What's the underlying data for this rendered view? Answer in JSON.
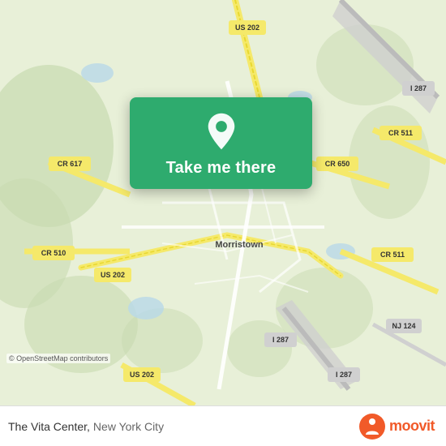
{
  "map": {
    "attribution": "© OpenStreetMap contributors"
  },
  "card": {
    "button_label": "Take me there",
    "pin_icon": "location-pin"
  },
  "bottom_bar": {
    "location_name": "The Vita Center,",
    "location_city": "New York City",
    "logo_text": "moovit"
  },
  "roads": {
    "cr617": "CR 617",
    "cr650": "CR 650",
    "cr511_top": "CR 511",
    "cr511_mid": "CR 511",
    "cr510": "CR 510",
    "us202_top": "US 202",
    "us202_mid": "US 202",
    "us202_bot": "US 202",
    "i287_top": "I 287",
    "i287_bot": "I 287",
    "nj124": "NJ 124",
    "morristown": "Morristown"
  },
  "colors": {
    "card_green": "#2eab6e",
    "map_bg": "#e8f0d8",
    "road_yellow": "#f5e96a",
    "road_white": "#ffffff",
    "road_gray": "#cccccc",
    "moovit_orange": "#f15a29",
    "water": "#b8d8e8",
    "forest": "#c8dab0"
  }
}
